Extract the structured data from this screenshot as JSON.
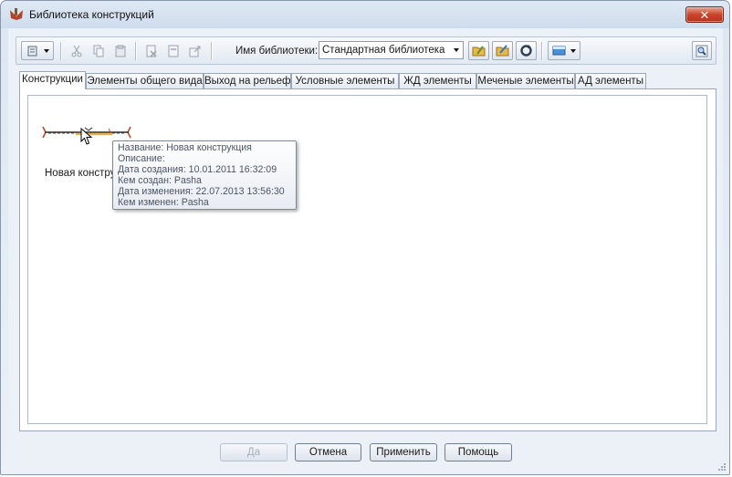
{
  "window": {
    "title": "Библиотека конструкций",
    "close_glyph": "✕"
  },
  "toolbar": {
    "library_label": "Имя библиотеки:",
    "library_value": "Стандартная библиотека",
    "icons": [
      "library-menu-icon",
      "cut-icon",
      "copy-icon",
      "paste-icon",
      "delete-icon",
      "properties-icon",
      "export-icon",
      "folder-open-icon",
      "folder-save-icon",
      "refresh-icon",
      "view-mode-icon",
      "search-icon"
    ]
  },
  "tabs": [
    {
      "label": "Конструкции",
      "active": true
    },
    {
      "label": "Элементы общего вида",
      "active": false
    },
    {
      "label": "Выход на рельеф",
      "active": false
    },
    {
      "label": "Условные элементы",
      "active": false
    },
    {
      "label": "ЖД элементы",
      "active": false
    },
    {
      "label": "Меченые элементы",
      "active": false
    },
    {
      "label": "АД элементы",
      "active": false
    }
  ],
  "item": {
    "label": "Новая констру"
  },
  "tooltip": {
    "lines": [
      "Название: Новая конструкция",
      "Описание:",
      "Дата создания: 10.01.2011 16:32:09",
      "Кем создан: Pasha",
      "Дата изменения: 22.07.2013 13:56:30",
      "Кем изменен: Pasha"
    ]
  },
  "buttons": {
    "ok": "Да",
    "cancel": "Отмена",
    "apply": "Применить",
    "help": "Помощь"
  },
  "colors": {
    "accent": "#c9452c",
    "preview_line": "#b04a2a",
    "preview_fill": "#e3b24a"
  }
}
